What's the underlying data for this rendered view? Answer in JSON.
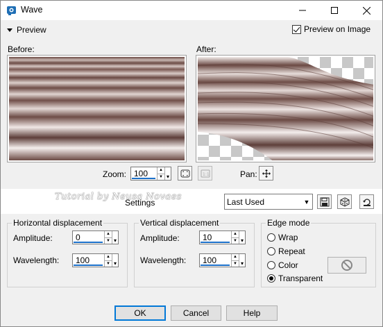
{
  "window": {
    "title": "Wave"
  },
  "preview": {
    "toggle_label": "Preview",
    "preview_on_image_label": "Preview on Image",
    "preview_on_image_checked": true,
    "before_label": "Before:",
    "after_label": "After:"
  },
  "zoom": {
    "label": "Zoom:",
    "value": "100"
  },
  "pan": {
    "label": "Pan:"
  },
  "settings": {
    "watermark": "Tutorial by Neusa Novaes",
    "label": "Settings",
    "preset_value": "Last Used"
  },
  "horizontal": {
    "title": "Horizontal displacement",
    "amplitude_label": "Amplitude:",
    "amplitude_value": "0",
    "wavelength_label": "Wavelength:",
    "wavelength_value": "100"
  },
  "vertical": {
    "title": "Vertical displacement",
    "amplitude_label": "Amplitude:",
    "amplitude_value": "10",
    "wavelength_label": "Wavelength:",
    "wavelength_value": "100"
  },
  "edge_mode": {
    "title": "Edge mode",
    "options": [
      "Wrap",
      "Repeat",
      "Color",
      "Transparent"
    ],
    "selected": "Transparent"
  },
  "buttons": {
    "ok": "OK",
    "cancel": "Cancel",
    "help": "Help"
  },
  "colors": {
    "accent": "#0078d7",
    "wave_dark": "#6b4a44",
    "wave_light": "#f0e8e6"
  }
}
